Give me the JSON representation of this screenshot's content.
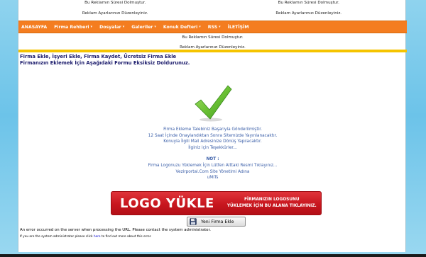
{
  "ads_top": {
    "left": [
      "Bu Reklamın Süresi Dolmuştur.",
      "Reklam Ayarlarınızı Düzenleyiniz."
    ],
    "right": [
      "Bu Reklamın Süresi Dolmuştur.",
      "Reklam Ayarlarınızı Düzenleyiniz."
    ]
  },
  "nav": {
    "items": [
      {
        "label": "ANASAYFA",
        "has_dropdown": false
      },
      {
        "label": "Firma Rehberi",
        "has_dropdown": true
      },
      {
        "label": "Dosyalar",
        "has_dropdown": true
      },
      {
        "label": "Galeriler",
        "has_dropdown": true
      },
      {
        "label": "Konuk Defteri",
        "has_dropdown": true
      },
      {
        "label": "RSS",
        "has_dropdown": true
      },
      {
        "label": "İLETİŞİM",
        "has_dropdown": false
      }
    ],
    "chevron": "▾"
  },
  "ads_mid": [
    "Bu Reklamın Süresi Dolmuştur.",
    "Reklam Ayarlarınızı Düzenleyiniz."
  ],
  "headline": {
    "line1": "Firma Ekle, İşyeri Ekle, Firma Kaydet, Ücretsiz Firma Ekle",
    "line2": "Firmanızın Eklemek İçin Aşağıdaki Formu Eksiksiz Doldurunuz."
  },
  "message": {
    "lines": [
      "Firma Ekleme Talebiniz Başarıyla Gönderilmiştir.",
      "12 Saat İçinde Onaylandıktan Sonra Sitemizde Yayınlanacaktır.",
      "Konuyla İlgili Mail Adresinize Dönüş Yapılacaktır.",
      "İlginiz için Teşekkürler..."
    ],
    "note_label": "NOT :",
    "note_lines": [
      "Firma Logonuzu Yüklemek İçin Lütfen Alttaki Resmi Tıklayınız...",
      "Vezirportal.Com Site Yönetimi Adına",
      "uMiTs"
    ]
  },
  "logo_banner": {
    "main": "LOGO YÜKLE",
    "sub1": "FİRMANIZIN LOGOSUNU",
    "sub2": "YÜKLEMEK İÇİN BU ALANA TIKLAYINIZ."
  },
  "new_button": {
    "label": "Yeni Firma Ekle",
    "icon": "floppy-disk-icon"
  },
  "errors": {
    "line1": "An error occurred on the server when processing the URL. Please contact the system administrator.",
    "line2_pre": "If you are the system administrator please click",
    "line2_link": "here",
    "line2_post": "to find out more about this error."
  },
  "colors": {
    "nav_bg": "#f47d20",
    "accent_yellow": "#f5c400",
    "message_text": "#3a5ea8",
    "banner_red": "#c8161e",
    "check_green": "#5ab52a"
  }
}
